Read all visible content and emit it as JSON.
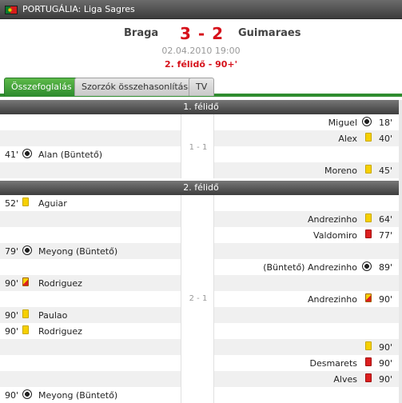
{
  "header": {
    "league": "PORTUGÁLIA: Liga Sagres",
    "home_team": "Braga",
    "away_team": "Guimaraes",
    "score": "3 - 2",
    "datetime": "02.04.2010 19:00",
    "status": "2. félidő - 90+'"
  },
  "tabs": [
    {
      "label": "Összefoglalás",
      "active": true
    },
    {
      "label": "Szorzók összehasonlítása",
      "active": false
    },
    {
      "label": "TV",
      "active": false
    }
  ],
  "halves": [
    {
      "title": "1. félidő",
      "score": "1 - 1"
    },
    {
      "title": "2. félidő",
      "score": "2 - 1"
    }
  ],
  "events_first_half": [
    {
      "side": "away",
      "minute": "18'",
      "icon": "goal",
      "player": "Miguel"
    },
    {
      "side": "away",
      "minute": "40'",
      "icon": "yellow-card",
      "player": "Alex"
    },
    {
      "side": "home",
      "minute": "41'",
      "icon": "goal",
      "player": "Alan (Büntető)"
    },
    {
      "side": "away",
      "minute": "45'",
      "icon": "yellow-card",
      "player": "Moreno"
    }
  ],
  "events_second_half": [
    {
      "side": "home",
      "minute": "52'",
      "icon": "yellow-card",
      "player": "Aguiar"
    },
    {
      "side": "away",
      "minute": "64'",
      "icon": "yellow-card",
      "player": "Andrezinho"
    },
    {
      "side": "away",
      "minute": "77'",
      "icon": "red-card",
      "player": "Valdomiro"
    },
    {
      "side": "home",
      "minute": "79'",
      "icon": "goal",
      "player": "Meyong (Büntető)"
    },
    {
      "side": "away",
      "minute": "89'",
      "icon": "goal",
      "player": "(Büntető) Andrezinho"
    },
    {
      "side": "home",
      "minute": "90'",
      "icon": "second-yellow",
      "player": "Rodriguez"
    },
    {
      "side": "away",
      "minute": "90'",
      "icon": "second-yellow",
      "player": "Andrezinho"
    },
    {
      "side": "home",
      "minute": "90'",
      "icon": "yellow-card",
      "player": "Paulao"
    },
    {
      "side": "home",
      "minute": "90'",
      "icon": "yellow-card",
      "player": "Rodriguez"
    },
    {
      "side": "away",
      "minute": "90'",
      "icon": "yellow-card",
      "player": ""
    },
    {
      "side": "away",
      "minute": "90'",
      "icon": "red-card",
      "player": "Desmarets"
    },
    {
      "side": "away",
      "minute": "90'",
      "icon": "red-card",
      "player": "Alves"
    },
    {
      "side": "home",
      "minute": "90'",
      "icon": "goal",
      "player": "Meyong (Büntető)"
    }
  ],
  "colors": {
    "accent_green": "#2f8c2f",
    "score_red": "#d6101a",
    "yellow_card": "#f6d000",
    "red_card": "#dd1f1f"
  }
}
